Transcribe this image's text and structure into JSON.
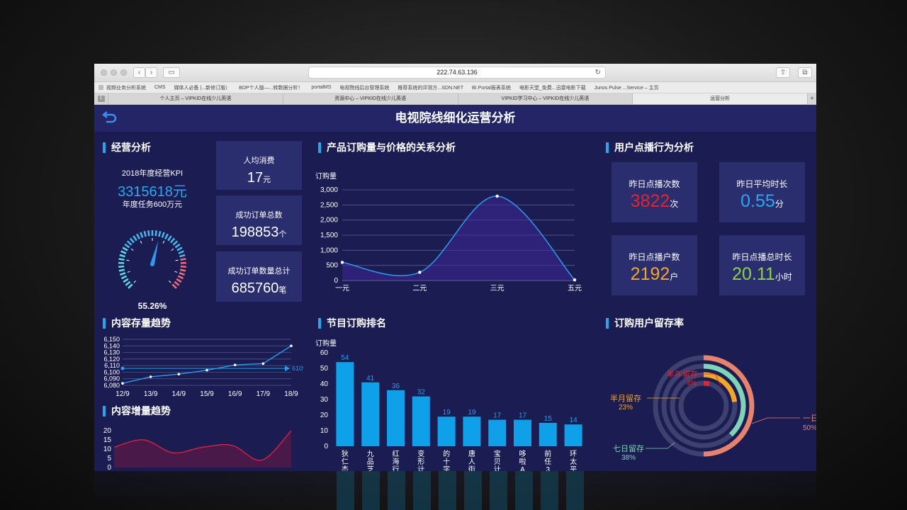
{
  "browser": {
    "url": "222.74.63.136",
    "bookmarks": [
      "视频业务分析系统",
      "CMS",
      "媒体人必备 |...新修订版）",
      "BDP个人版—...转数据分析！",
      "portalMS",
      "电视院线后台管理系统",
      "推荐系统的评测方...SDN.NET",
      "BI.Portal报表系统",
      "电影天堂_免费...迅雷电影下载",
      "Junos Pulse ...Service – 主页"
    ],
    "tabs": [
      "个人主页 – VIPKID在线少儿英语",
      "资源中心 – VIPKID在线少儿英语",
      "VIPKID学习中心 – VIPKID在线少儿英语",
      "运营分析"
    ],
    "active_tab": 3
  },
  "dashboard": {
    "title": "电视院线细化运营分析",
    "sections": {
      "operations": "经营分析",
      "price_relation": "产品订购量与价格的关系分析",
      "play_behavior": "用户点播行为分析",
      "content_stock": "内容存量趋势",
      "program_rank": "节目订购排名",
      "retention": "订购用户留存率",
      "content_increment": "内容增量趋势"
    },
    "kpi": {
      "label": "2018年度经营KPI",
      "value": "3315618元",
      "task": "年度任务600万元",
      "gauge_percent": "55.26%",
      "gauge_fraction": 0.5526
    },
    "stats": [
      {
        "label": "人均消费",
        "value": "17",
        "unit": "元"
      },
      {
        "label": "成功订单总数",
        "value": "198853",
        "unit": "个"
      },
      {
        "label": "成功订单数量总计",
        "value": "685760",
        "unit": "笔"
      }
    ],
    "play_stats": [
      {
        "label": "昨日点播次数",
        "value": "3822",
        "unit": "次",
        "color": "#e8232a"
      },
      {
        "label": "昨日平均时长",
        "value": "0.55",
        "unit": "分",
        "color": "#29a9f0"
      },
      {
        "label": "昨日点播户数",
        "value": "2192",
        "unit": "户",
        "color": "#f5a623"
      },
      {
        "label": "昨日点播总时长",
        "value": "20.11",
        "unit": "小时",
        "color": "#8bd34a"
      }
    ],
    "colors": {
      "accent": "#25a8ee",
      "panel": "#2a2d6e",
      "bg": "#1b1c52",
      "header": "#232567"
    }
  },
  "chart_data": [
    {
      "type": "line",
      "title": "产品订购量与价格的关系分析",
      "ylabel": "订购量",
      "categories": [
        "一元",
        "二元",
        "三元",
        "五元"
      ],
      "values": [
        600,
        270,
        2790,
        20
      ],
      "ylim": [
        0,
        3000
      ],
      "yticks": [
        "0",
        "500",
        "1,000",
        "1,500",
        "2,000",
        "2,500",
        "3,000"
      ],
      "grid": true
    },
    {
      "type": "line",
      "title": "内容存量趋势",
      "categories": [
        "12/9",
        "13/9",
        "14/9",
        "15/9",
        "16/9",
        "17/9",
        "18/9"
      ],
      "values": [
        6083,
        6093,
        6097,
        6103,
        6111,
        6113,
        6140
      ],
      "ylim": [
        6080,
        6150
      ],
      "yticks": [
        "6,080",
        "6,090",
        "6,100",
        "6,110",
        "6,120",
        "6,130",
        "6,140",
        "6,150"
      ],
      "markline_label": "6109.7",
      "grid": true
    },
    {
      "type": "area",
      "title": "内容增量趋势",
      "values": [
        11,
        15,
        8,
        11,
        12,
        4,
        20
      ],
      "ylim": [
        0,
        20
      ],
      "yticks": [
        "0",
        "5",
        "10",
        "15",
        "20"
      ]
    },
    {
      "type": "bar",
      "title": "节目订购排名",
      "ylabel": "订购量",
      "categories": [
        "狄仁杰",
        "九品芝",
        "红海行",
        "变形计",
        "的十字",
        "唐人街",
        "宝贝计",
        "哆啦A",
        "前任3",
        "环太平"
      ],
      "values": [
        54,
        41,
        36,
        32,
        19,
        19,
        17,
        17,
        15,
        14
      ],
      "ylim": [
        0,
        60
      ],
      "yticks": [
        "0",
        "10",
        "20",
        "30",
        "40",
        "50",
        "60"
      ]
    },
    {
      "type": "pie",
      "title": "订购用户留存率",
      "slices": [
        {
          "name": "一日留存",
          "value": 50,
          "label": "50%",
          "color": "#e8826a"
        },
        {
          "name": "七日留存",
          "value": 38,
          "label": "38%",
          "color": "#7fd3b6"
        },
        {
          "name": "半月留存",
          "value": 23,
          "label": "23%",
          "color": "#f5a623"
        },
        {
          "name": "半年留存",
          "value": 4,
          "label": "4%",
          "color": "#e8232a"
        }
      ]
    }
  ]
}
